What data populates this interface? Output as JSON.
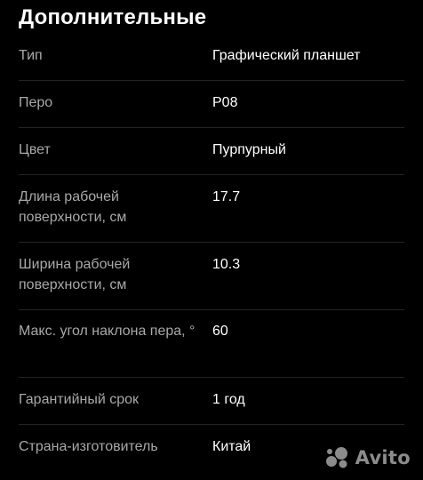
{
  "section": {
    "title": "Дополнительные"
  },
  "specs": [
    {
      "label": "Тип",
      "value": "Графический планшет"
    },
    {
      "label": "Перо",
      "value": "P08"
    },
    {
      "label": "Цвет",
      "value": "Пурпурный"
    },
    {
      "label": "Длина рабочей поверхности, см",
      "value": "17.7"
    },
    {
      "label": "Ширина рабочей поверхности, см",
      "value": "10.3"
    },
    {
      "label": "Макс. угол наклона пера, °",
      "value": "60"
    },
    {
      "label": "Гарантийный срок",
      "value": "1 год"
    },
    {
      "label": "Страна-изготовитель",
      "value": "Китай"
    }
  ],
  "watermark": {
    "text": "Avito",
    "icon": "avito-logo-icon"
  },
  "colors": {
    "background": "#000000",
    "label": "#a8a8a8",
    "value": "#ffffff",
    "divider": "#232323"
  }
}
